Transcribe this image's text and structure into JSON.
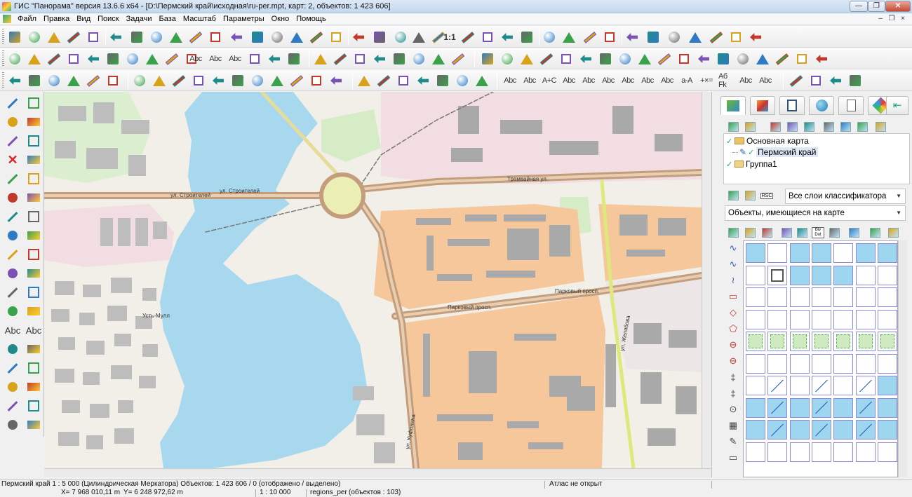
{
  "window": {
    "title": "ГИС \"Панорама\" версия 13.6.6 x64 - [D:\\Пермский край\\исходная\\ru-per.mpt, карт: 2, объектов: 1 423 606]",
    "minimize_glyph": "—",
    "restore_glyph": "❐",
    "close_glyph": "✕"
  },
  "menu": {
    "items": [
      "Файл",
      "Правка",
      "Вид",
      "Поиск",
      "Задачи",
      "База",
      "Масштаб",
      "Параметры",
      "Окно",
      "Помощь"
    ],
    "mdi_glyphs": [
      "–",
      "❐",
      "×"
    ]
  },
  "toolbar": {
    "zoom_label": "1:1",
    "text_tools": [
      "Abc",
      "Abc",
      "Abc",
      "Abc",
      "Abc",
      "A+C",
      "Abc",
      "Abc",
      "Abc",
      "Abc",
      "Abc",
      "Abc",
      "a-A",
      "+×=",
      "Аб Fk"
    ]
  },
  "left_tools": {
    "text_labels": [
      "Abc",
      "Abc"
    ]
  },
  "map": {
    "labels": {
      "street_stroiteley_1": "ул. Строителей",
      "street_stroiteley_2": "ул. Строителей",
      "street_tramvaynaya": "Трамвайная ул.",
      "prospect_parkovy_1": "Парковый просп.",
      "prospect_parkovy_2": "Парковый просп.",
      "street_zhelyabova": "ул. Желябова",
      "street_kufonina": "ул. Куфонина",
      "locality": "Усть-Мулл"
    },
    "colors": {
      "water": "#a8d8ee",
      "residential": "#f6c79a",
      "industrial": "#f1dde2",
      "grass": "#d6ecc6",
      "building": "#a9a9a9",
      "road": "#c49e7c"
    }
  },
  "right_panel": {
    "tree": [
      {
        "label": "Основная карта",
        "level": 0,
        "checked": true,
        "icon": "folder-open-icon"
      },
      {
        "label": "Пермский край",
        "level": 1,
        "checked": true,
        "icon": "pen-icon"
      },
      {
        "label": "Группа1",
        "level": 0,
        "checked": true,
        "icon": "folder-icon"
      }
    ],
    "layers_combo": "Все слои классификатора",
    "objects_combo": "Объекты, имеющиеся на карте",
    "toolbar_labels": [
      "RSC",
      "Biv Dot"
    ]
  },
  "status": {
    "map_info": "Пермский край  1 : 5 000  (Цилиндрическая Меркатора) Объектов: 1 423 606 / 0 (отображено / выделено)",
    "atlas": "Атлас не открыт",
    "x_coord": "X= 7 968 010,11 m",
    "y_coord": "Y= 6 248 972,62 m",
    "scale": "1 : 10 000",
    "layer": "regions_per",
    "layer_objects": "(объектов : 103)"
  }
}
